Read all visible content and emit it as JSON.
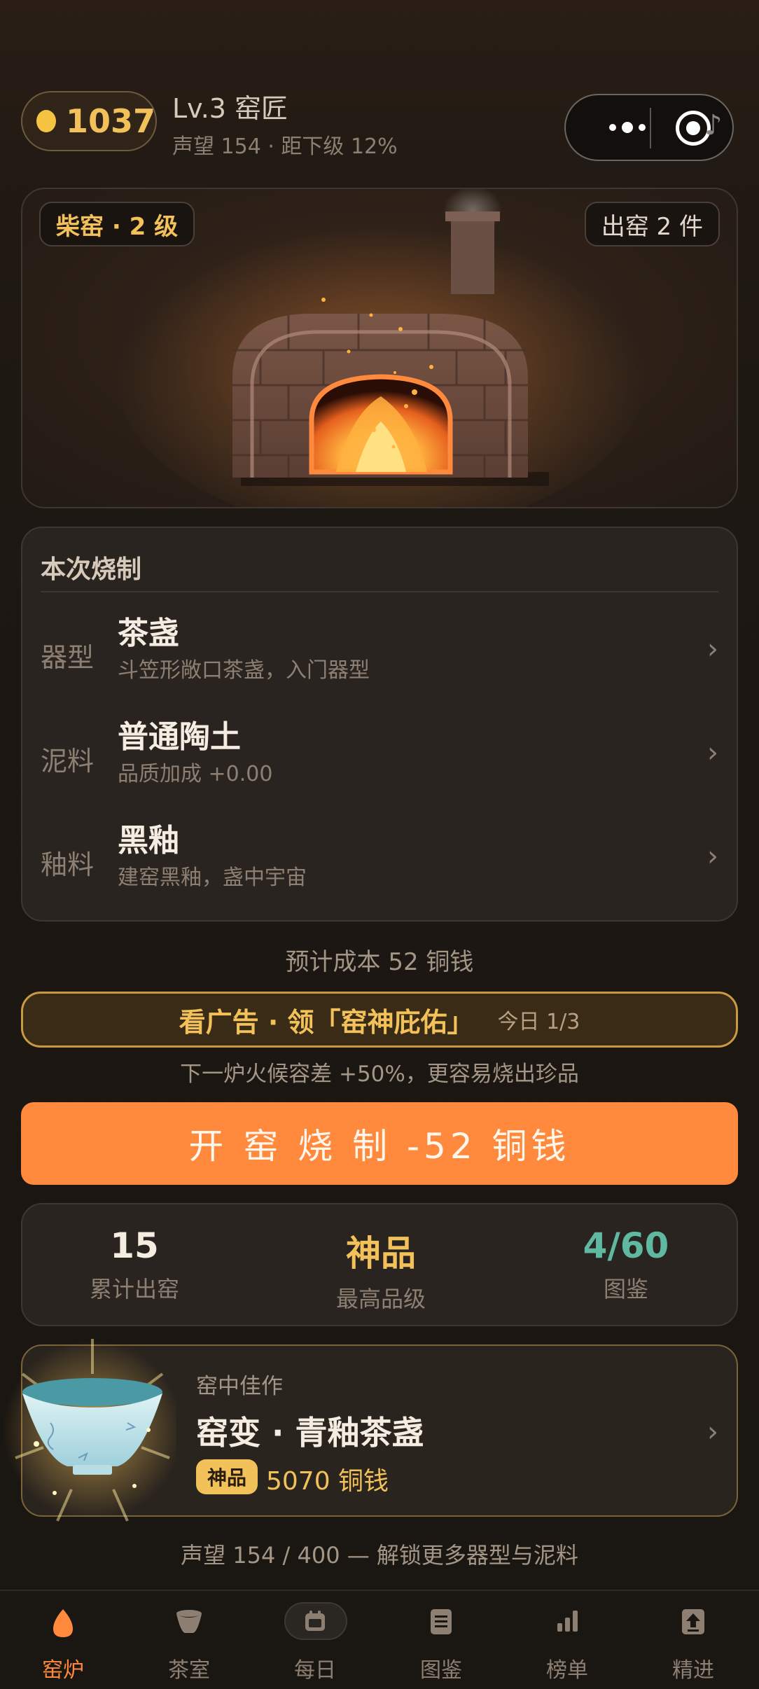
{
  "header": {
    "coins": "1037",
    "level_title": "Lv.3 窑匠",
    "level_sub": "声望 154 · 距下级 12%"
  },
  "kiln": {
    "name_chip": "柴窑 · 2 级",
    "output_chip": "出窑 2 件"
  },
  "recipe": {
    "heading": "本次烧制",
    "rows": [
      {
        "key": "器型",
        "title": "茶盏",
        "desc": "斗笠形敞口茶盏，入门器型"
      },
      {
        "key": "泥料",
        "title": "普通陶土",
        "desc": "品质加成 +0.00"
      },
      {
        "key": "釉料",
        "title": "黑釉",
        "desc": "建窑黑釉，盏中宇宙"
      }
    ],
    "chevron": "›"
  },
  "cost_line": "预计成本 52 铜钱",
  "ad": {
    "main": "看广告 · 领「窑神庇佑」",
    "sub": "今日 1/3",
    "note": "下一炉火候容差 +50%，更容易烧出珍品"
  },
  "fire_button": "开 窑 烧 制   -52 铜钱",
  "stats": [
    {
      "value": "15",
      "label": "累计出窑",
      "color": "#f5ece2"
    },
    {
      "value": "神品",
      "label": "最高品级",
      "color": "#f3c15a"
    },
    {
      "value": "4/60",
      "label": "图鉴",
      "color": "#5fb8a0"
    }
  ],
  "masterpiece": {
    "kicker": "窑中佳作",
    "title": "窑变 · 青釉茶盏",
    "badge": "神品",
    "price": "5070 铜钱",
    "chevron": "›"
  },
  "reputation_line": "声望 154 / 400 — 解锁更多器型与泥料",
  "tabs": [
    {
      "label": "窑炉",
      "icon": "flame-icon",
      "active": true
    },
    {
      "label": "茶室",
      "icon": "tea-bowl-icon",
      "active": false
    },
    {
      "label": "每日",
      "icon": "calendar-icon",
      "active": false
    },
    {
      "label": "图鉴",
      "icon": "catalog-icon",
      "active": false
    },
    {
      "label": "榜单",
      "icon": "bar-chart-icon",
      "active": false
    },
    {
      "label": "精进",
      "icon": "upgrade-icon",
      "active": false
    }
  ],
  "colors": {
    "accent": "#ff8a3d",
    "gold": "#f3c15a",
    "teal": "#5fb8a0"
  }
}
